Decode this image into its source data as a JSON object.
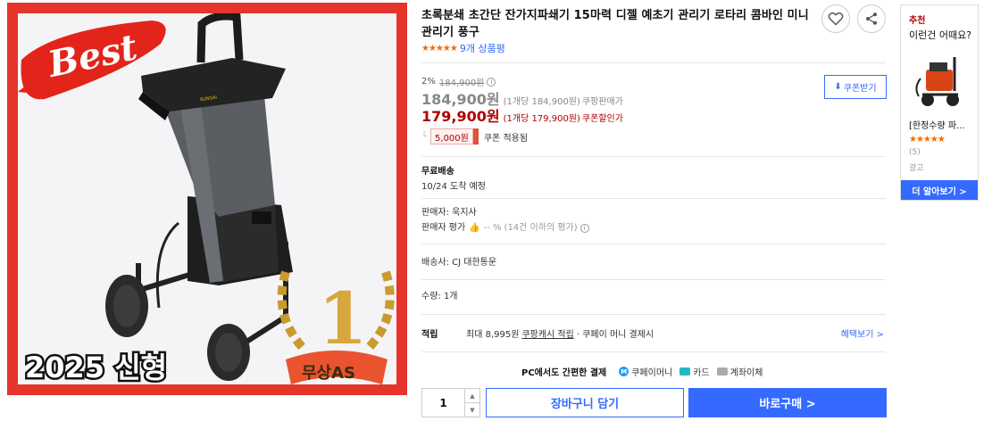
{
  "product_image": {
    "badge_best": "Best",
    "machine_brand": "KUNSAI",
    "new_model": "2025 신형",
    "rank_number": "1",
    "free_as": "무상AS"
  },
  "product": {
    "title": "초록분쇄 초간단 잔가지파쇄기 15마력 디젤 예초기 관리기 로타리 콤바인 미니관리기 풍구",
    "rating_stars": "★★★★★",
    "review_count": "9개 상품평"
  },
  "price": {
    "discount_rate": "2%",
    "original_price": "184,900원",
    "info_icon": "i",
    "coupon_button": "쿠폰받기",
    "sale_price": "184,900원",
    "sale_unit": "(1개당 184,900원)",
    "sale_label": "쿠팡판매가",
    "coupon_price": "179,900원",
    "coupon_unit": "(1개당 179,900원)",
    "coupon_label": "쿠폰할인가",
    "coupon_amount": "5,000원",
    "coupon_applied_text": "쿠폰 적용됨"
  },
  "shipping": {
    "title": "무료배송",
    "arrival": "10/24 도착 예정"
  },
  "seller": {
    "name": "판매자: 욱지사",
    "rating_label": "판매자 평가",
    "rating_value": "-- %",
    "rating_note": "(14건 이하의 평가)"
  },
  "delivery_company": "배송사: CJ 대한통운",
  "quantity_label": "수량: 1개",
  "benefit": {
    "label": "적립",
    "text_prefix": "최대 8,995원",
    "text_link": "쿠팡캐시 적립",
    "text_suffix": "· 쿠페이 머니 결제시",
    "link": "혜택보기 >"
  },
  "payment": {
    "title": "PC에서도 간편한 결제",
    "option1": "쿠페이머니",
    "option2": "카드",
    "option3": "계좌이체"
  },
  "purchase": {
    "quantity": "1",
    "cart_button": "장바구니 담기",
    "buy_button": "바로구매 >"
  },
  "recommendation": {
    "tag": "추천",
    "heading": "이런건 어때요?",
    "item_name": "[한정수량 파...",
    "item_stars": "★★★★★",
    "item_count": "(5)",
    "ad_label": "광고",
    "more_button": "더 알아보기 >"
  },
  "colors": {
    "accent_blue": "#346aff",
    "price_red": "#ae0000",
    "star_orange": "#f36b00",
    "frame_red": "#e5352a"
  }
}
